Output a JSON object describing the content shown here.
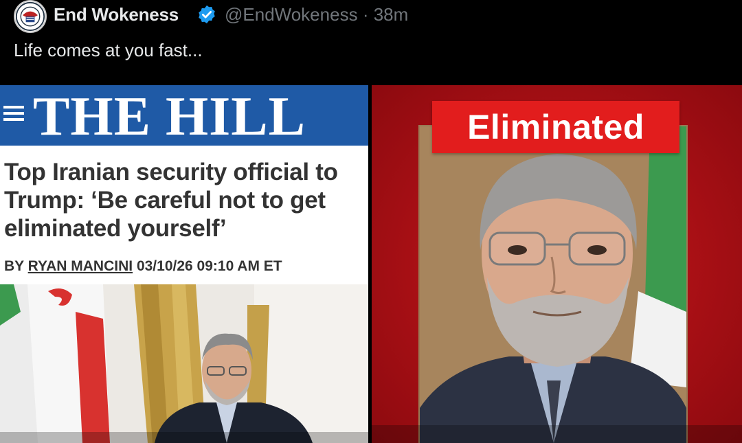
{
  "tweet": {
    "display_name": "End Wokeness",
    "verified_icon": "verified-badge-icon",
    "handle": "@EndWokeness",
    "separator": "·",
    "time": "38m",
    "text": "Life comes at you fast..."
  },
  "media": {
    "left": {
      "logo": "THE HILL",
      "menu_icon": "hamburger-menu-icon",
      "headline": "Top Iranian security official to Trump: ‘Be careful not to get eliminated yourself’",
      "byline_prefix": "BY",
      "byline_author": "RYAN MANCINI",
      "byline_datetime": "03/10/26 09:10 AM ET"
    },
    "right": {
      "label": "Eliminated"
    }
  },
  "colors": {
    "background": "#000000",
    "hill_blue": "#1f5aa6",
    "eliminated_red": "#e21d1d",
    "verified_blue": "#1d9bf0",
    "handle_gray": "#71767b"
  }
}
